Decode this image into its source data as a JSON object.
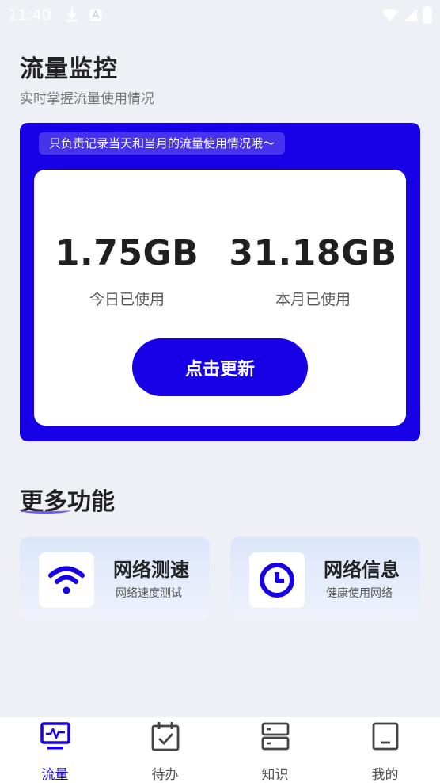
{
  "status_bar": {
    "time": "11:40"
  },
  "header": {
    "title": "流量监控",
    "subtitle": "实时掌握流量使用情况"
  },
  "usage_card": {
    "notice": "只负责记录当天和当月的流量使用情况哦～",
    "today_value": "1.75GB",
    "today_label": "今日已使用",
    "month_value": "31.18GB",
    "month_label": "本月已使用",
    "refresh_label": "点击更新"
  },
  "more_features": {
    "title": "更多功能",
    "items": [
      {
        "title": "网络测速",
        "desc": "网络速度测试",
        "icon": "wifi-icon"
      },
      {
        "title": "网络信息",
        "desc": "健康使用网络",
        "icon": "clock-icon"
      }
    ]
  },
  "tab_bar": {
    "items": [
      {
        "label": "流量",
        "icon": "monitor-pulse-icon",
        "active": true
      },
      {
        "label": "待办",
        "icon": "calendar-check-icon",
        "active": false
      },
      {
        "label": "知识",
        "icon": "server-icon",
        "active": false
      },
      {
        "label": "我的",
        "icon": "profile-icon",
        "active": false
      }
    ]
  },
  "colors": {
    "accent": "#1800e6",
    "background": "#eef0f6"
  }
}
